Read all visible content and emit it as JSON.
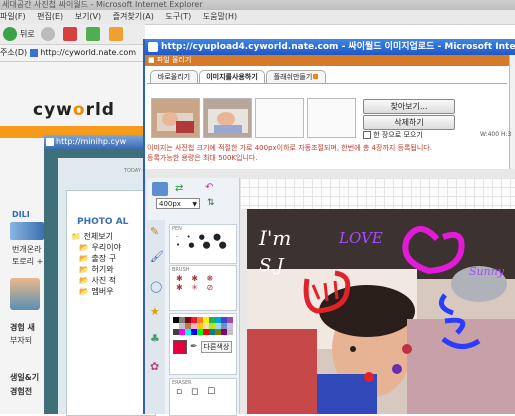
{
  "background_window": {
    "title": "세대공간 사진첩 싸이월드 - Microsoft Internet Explorer",
    "menu": [
      "파일(F)",
      "편집(E)",
      "보기(V)",
      "즐겨찾기(A)",
      "도구(T)",
      "도움말(H)"
    ],
    "back_label": "뒤로",
    "address_label": "주소(D)",
    "address_url": "http://cyworld.nate.com",
    "logo_text_left": "cyw",
    "logo_text_o": "o",
    "logo_text_right": "rld",
    "left_items": [
      "DILI",
      "번개온라",
      "토로리 +",
      "경험 새",
      "부자되",
      "생일&기",
      "경험전"
    ],
    "mini_window_url": "http://minihp.cyw",
    "mini_today": "TODAY 0",
    "mini_photo_label": "PHOTO AL",
    "mini_tree": [
      "전체보기",
      "우리이야",
      "출장 구",
      "허기와",
      "사진 적",
      "멤버우"
    ]
  },
  "popup": {
    "title": "http://cyupload4.cyworld.nate.com - 싸이월드 이미지업로드 - Microsoft Internet",
    "subtitle": "■ 파일 올리기",
    "tabs": [
      "바로올리기",
      "이미지를사용하기",
      "플래쉬만들기"
    ],
    "buttons": {
      "browse": "찾아보기...",
      "delete": "삭제하기"
    },
    "checkbox_label": "한 장으로 모으기",
    "size_note": "W:400 H:3",
    "notice_line1": "이미지는 사진첩 크기에 적절한 가로 400px이하로 자동조절되며, 한번에 총 4장까지 등록됩니다.",
    "notice_line2": "등록가능한 용량은 최대 500K입니다."
  },
  "editor": {
    "size_value": "400px",
    "pen_label": "PEN",
    "brush_label": "BRUSH",
    "eraser_label": "ERASER",
    "color_more_label": "다른색상",
    "palette": [
      "#000000",
      "#7f7f7f",
      "#880015",
      "#ed1c24",
      "#ff7f27",
      "#fff200",
      "#22b14c",
      "#00a2e8",
      "#3f48cc",
      "#a349a4",
      "#ffffff",
      "#c3c3c3",
      "#b97a57",
      "#ffaec9",
      "#ffc90e",
      "#efe4b0",
      "#b5e61d",
      "#99d9ea",
      "#7092be",
      "#c8bfe7",
      "#404040",
      "#ff00ff",
      "#00ffff",
      "#0000ff",
      "#00ff00",
      "#ff0000",
      "#008080",
      "#808000",
      "#800080",
      "#c0c0c0"
    ],
    "selected_color": "#e4003a",
    "doodle_text": [
      "I'm",
      "S.J",
      "LOVE",
      "Sunny"
    ],
    "doodle_colors": {
      "white": "#ffffff",
      "purple": "#a64dff",
      "magenta": "#e21bd9",
      "blue": "#2a3cff",
      "red": "#e0232b"
    }
  }
}
